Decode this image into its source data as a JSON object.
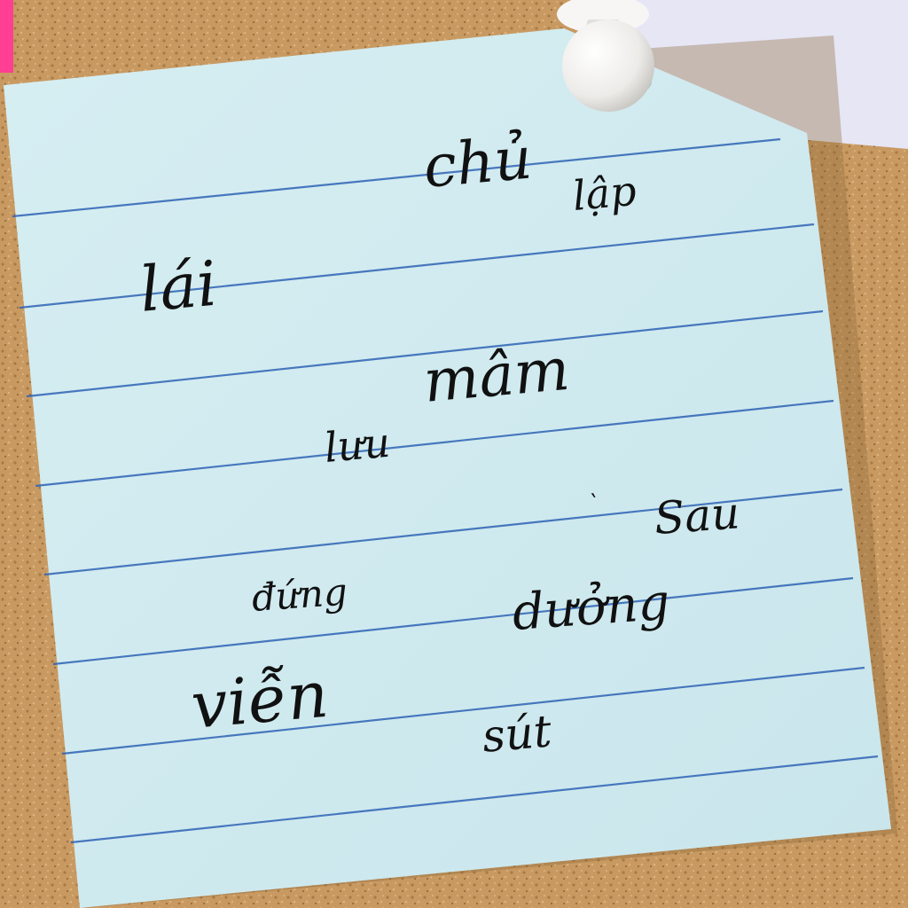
{
  "scene": {
    "background": "cork board",
    "note": "light blue lined sticky note pinned with white push pin",
    "colors": {
      "cork": "#c89a62",
      "note": "#cfe9ee",
      "rule_lines": "#2f63b5",
      "back_paper": "#e6e6f5",
      "pink_note": "#ff3f93",
      "pin": "#f4f4f2",
      "ink": "#111111"
    }
  },
  "handwriting": {
    "chu": "chủ",
    "lap": "lập",
    "lai": "lái",
    "mam": "mâm",
    "luu": "lưu",
    "mark": "`",
    "sau": "Sau",
    "dung": "đứng",
    "duong": "dưởng",
    "vien": "viễn",
    "sut": "sút"
  }
}
